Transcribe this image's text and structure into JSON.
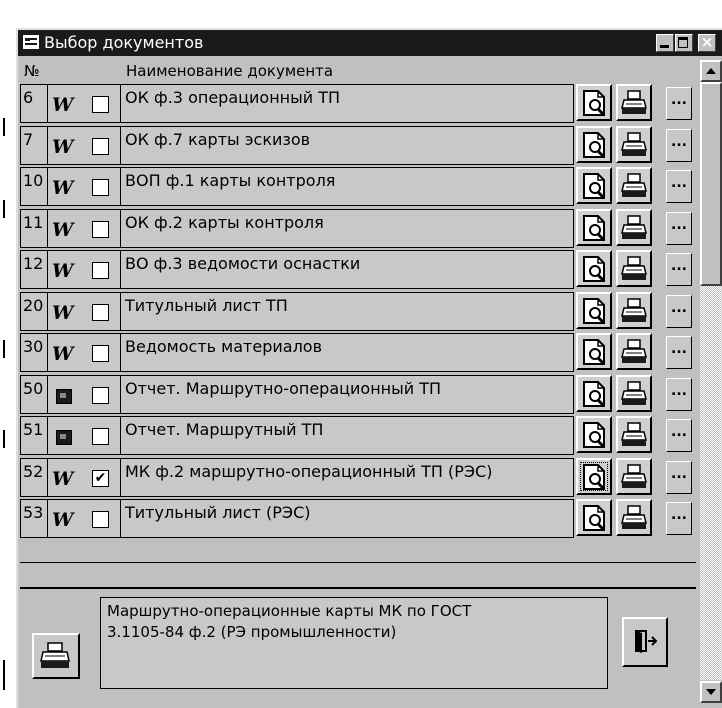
{
  "window": {
    "title": "Выбор документов"
  },
  "header": {
    "num_label": "№",
    "name_label": "Наименование документа"
  },
  "rows": [
    {
      "num": "6",
      "icon": "word-icon",
      "checked": false,
      "name": "ОК    ф.3   операционный ТП"
    },
    {
      "num": "7",
      "icon": "word-icon",
      "checked": false,
      "name": "ОК    ф.7   карты эскизов"
    },
    {
      "num": "10",
      "icon": "word-icon",
      "checked": false,
      "name": "ВОП  ф.1   карты контроля"
    },
    {
      "num": "11",
      "icon": "word-icon",
      "checked": false,
      "name": "ОК    ф.2   карты контроля"
    },
    {
      "num": "12",
      "icon": "word-icon",
      "checked": false,
      "name": "ВО    ф.3   ведомости оснастки"
    },
    {
      "num": "20",
      "icon": "word-icon",
      "checked": false,
      "name": "Титульный лист ТП"
    },
    {
      "num": "30",
      "icon": "word-icon",
      "checked": false,
      "name": "Ведомость материалов"
    },
    {
      "num": "50",
      "icon": "report-icon",
      "checked": false,
      "name": "Отчет. Маршрутно-операционный ТП"
    },
    {
      "num": "51",
      "icon": "report-icon",
      "checked": false,
      "name": "Отчет. Маршрутный ТП"
    },
    {
      "num": "52",
      "icon": "word-icon",
      "checked": true,
      "name": "МК ф.2 маршрутно-операционный ТП (РЭС)"
    },
    {
      "num": "53",
      "icon": "word-icon",
      "checked": false,
      "name": "Титульный лист (РЭС)"
    }
  ],
  "row_buttons": {
    "more_label": "..."
  },
  "description": {
    "line1": "Маршрутно-операционные карты МК по ГОСТ",
    "line2": "3.1105-84 ф.2 (РЭ промышленности)"
  },
  "checkmark": "✔",
  "word_glyph": "W",
  "close_glyph": "×",
  "selected_row": "52"
}
